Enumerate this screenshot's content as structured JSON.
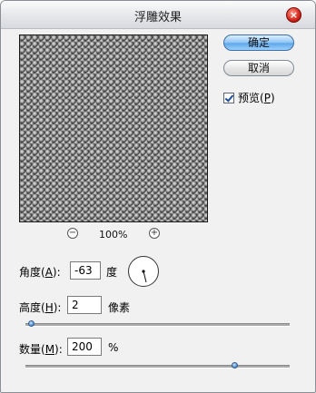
{
  "window": {
    "title": "浮雕效果"
  },
  "preview": {
    "zoom_level": "100%",
    "zoom_out_icon": "−",
    "zoom_in_icon": "+"
  },
  "buttons": {
    "ok_label": "确定",
    "cancel_label": "取消",
    "close_icon": "×"
  },
  "preview_checkbox": {
    "label_prefix": "预览(",
    "label_key": "P",
    "label_suffix": ")",
    "checked": true
  },
  "angle": {
    "label_prefix": "角度(",
    "label_key": "A",
    "label_suffix": "):",
    "value": "-63",
    "unit": "度"
  },
  "height": {
    "label_prefix": "高度(",
    "label_key": "H",
    "label_suffix": "):",
    "value": "2",
    "unit": "像素",
    "slider_fraction": 0.01
  },
  "amount": {
    "label_prefix": "数量(",
    "label_key": "M",
    "label_suffix": "):",
    "value": "200",
    "unit": "%",
    "slider_fraction": 0.8
  }
}
